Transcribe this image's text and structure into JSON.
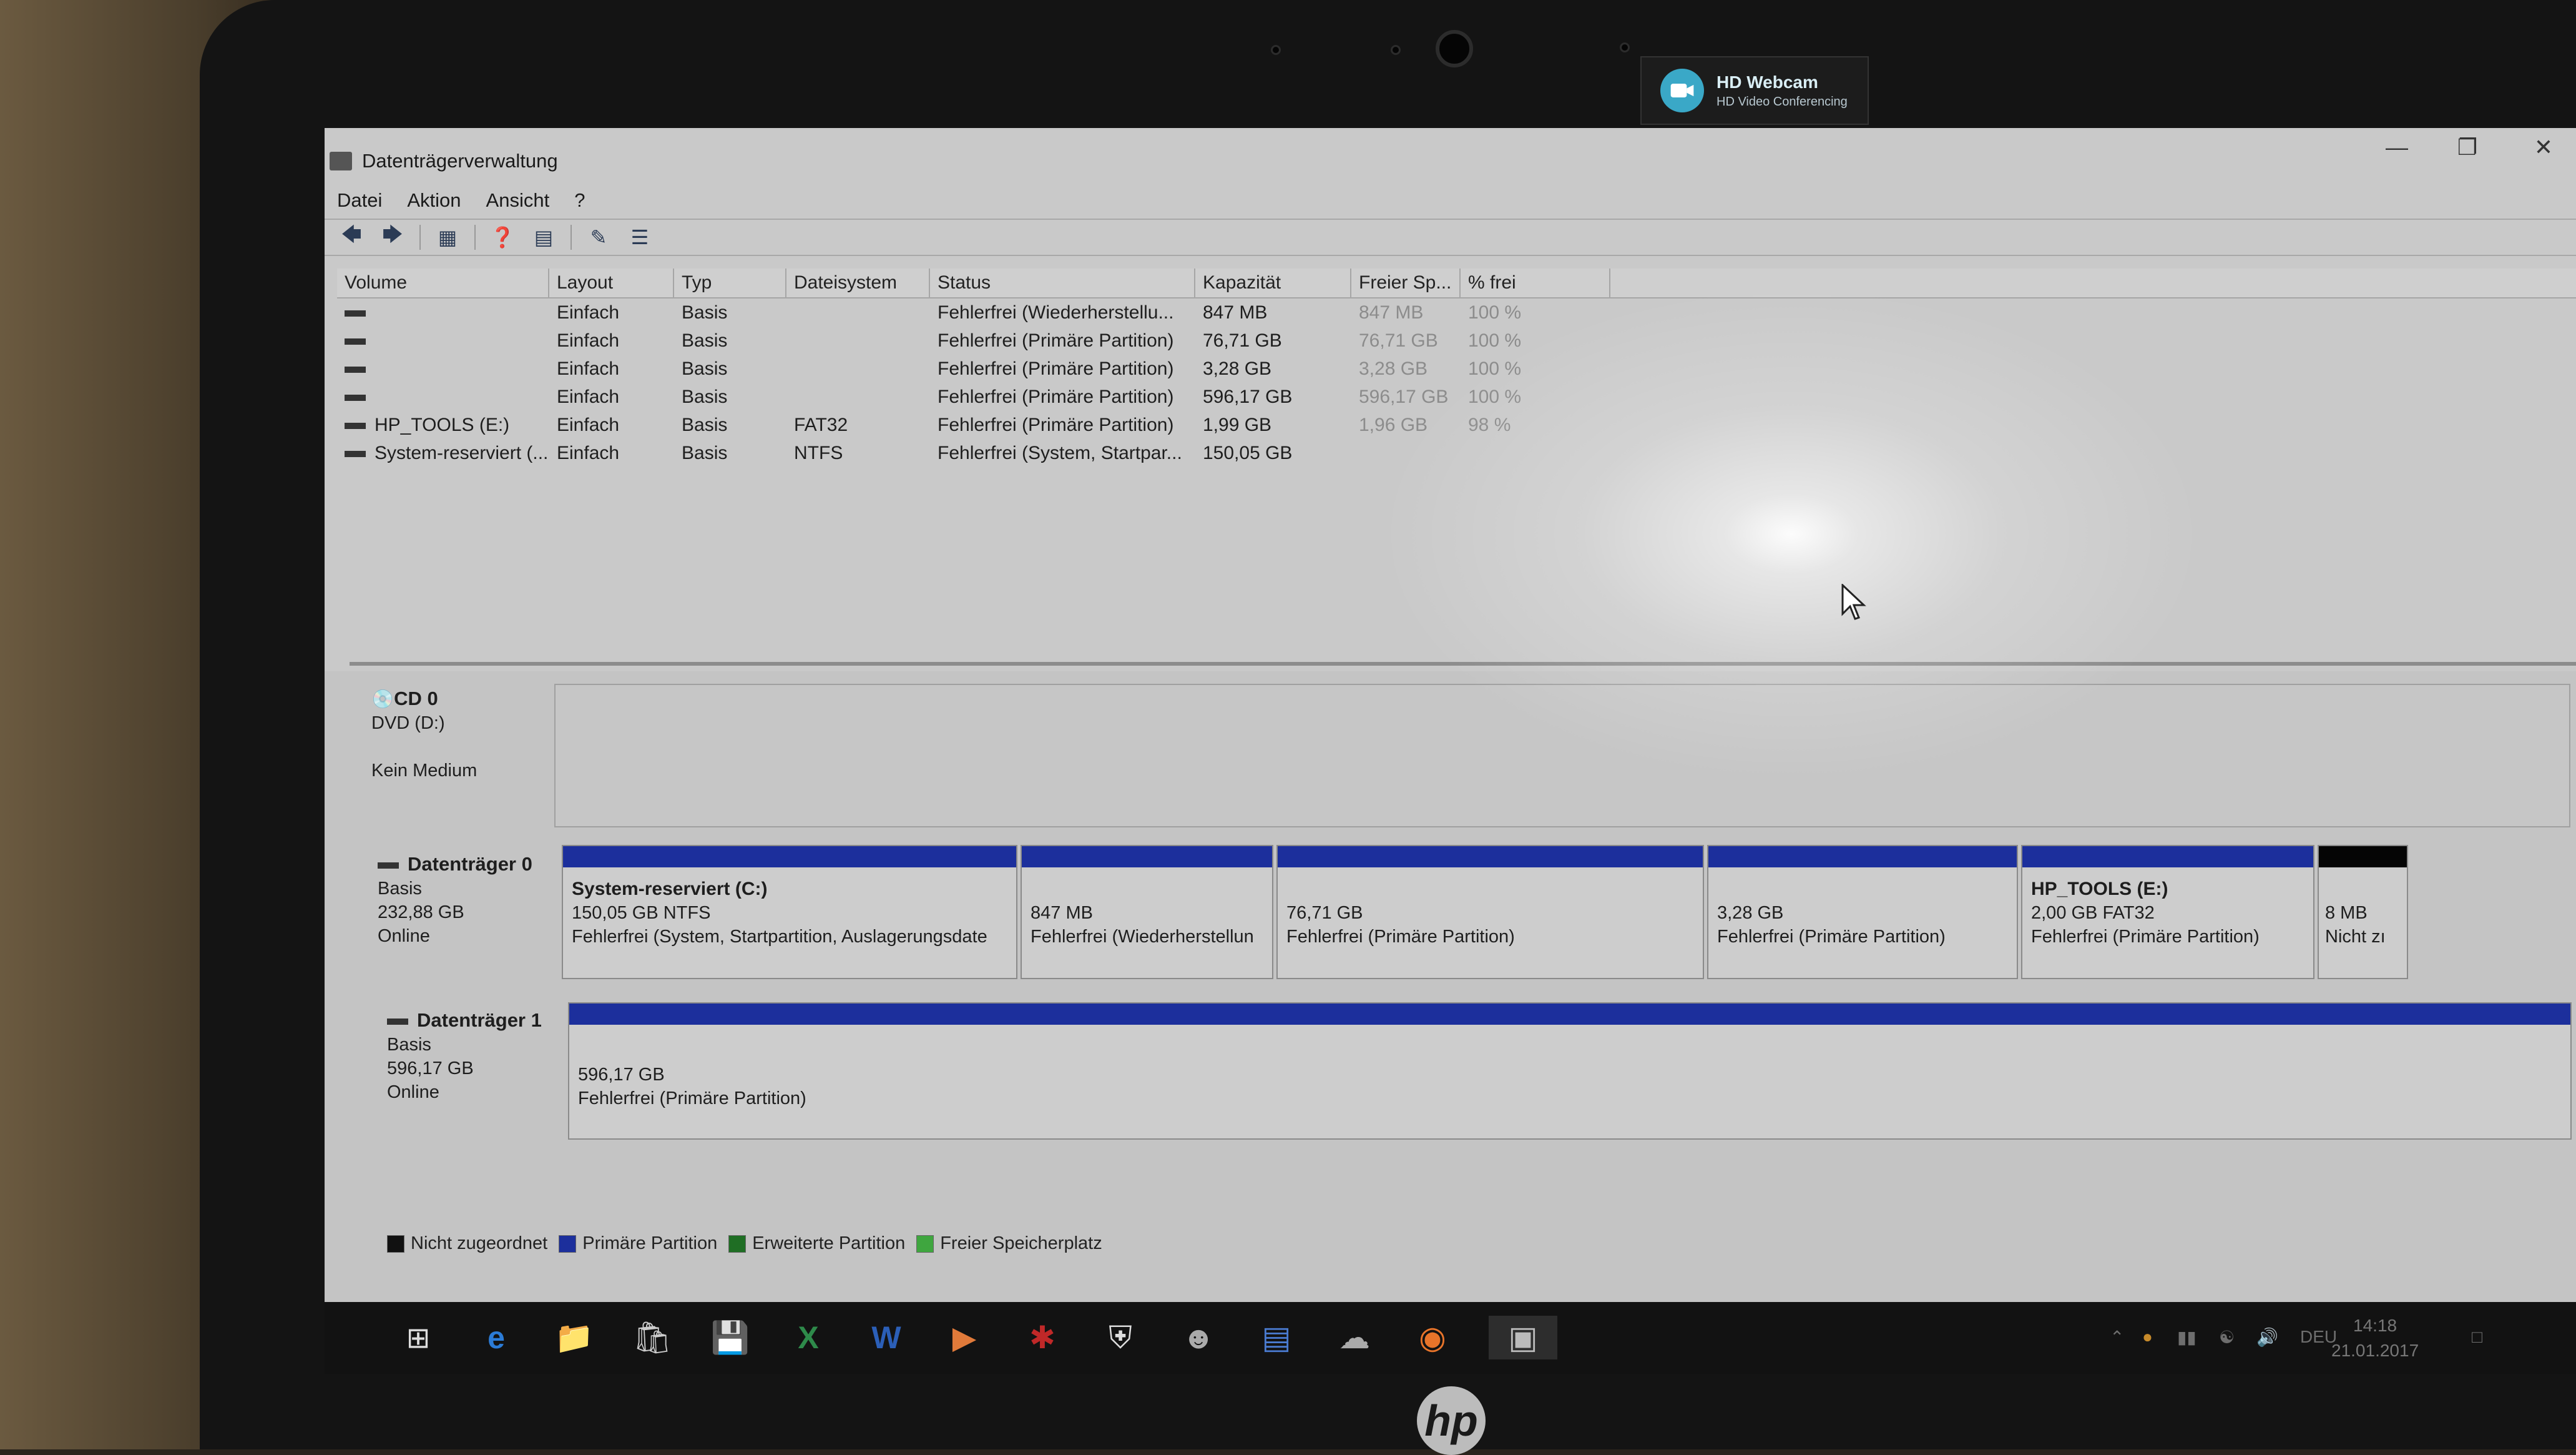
{
  "webcam": {
    "title": "HD Webcam",
    "subtitle": "HD Video Conferencing"
  },
  "device_logo": "hp",
  "window": {
    "title": "Datenträgerverwaltung"
  },
  "menu": [
    "Datei",
    "Aktion",
    "Ansicht",
    "?"
  ],
  "toolbar_icons": [
    "back-arrow-icon",
    "forward-arrow-icon",
    "console-tree-icon",
    "help-icon",
    "properties-icon",
    "refresh-icon",
    "list-view-icon"
  ],
  "volume_table": {
    "headers": [
      "Volume",
      "Layout",
      "Typ",
      "Dateisystem",
      "Status",
      "Kapazität",
      "Freier Sp...",
      "% frei"
    ],
    "rows": [
      {
        "volume": "",
        "layout": "Einfach",
        "typ": "Basis",
        "fs": "",
        "status": "Fehlerfrei (Wiederherstellu...",
        "cap": "847 MB",
        "free": "847 MB",
        "pct": "100 %"
      },
      {
        "volume": "",
        "layout": "Einfach",
        "typ": "Basis",
        "fs": "",
        "status": "Fehlerfrei (Primäre Partition)",
        "cap": "76,71 GB",
        "free": "76,71 GB",
        "pct": "100 %"
      },
      {
        "volume": "",
        "layout": "Einfach",
        "typ": "Basis",
        "fs": "",
        "status": "Fehlerfrei (Primäre Partition)",
        "cap": "3,28 GB",
        "free": "3,28 GB",
        "pct": "100 %"
      },
      {
        "volume": "",
        "layout": "Einfach",
        "typ": "Basis",
        "fs": "",
        "status": "Fehlerfrei (Primäre Partition)",
        "cap": "596,17 GB",
        "free": "596,17 GB",
        "pct": "100 %"
      },
      {
        "volume": "HP_TOOLS (E:)",
        "layout": "Einfach",
        "typ": "Basis",
        "fs": "FAT32",
        "status": "Fehlerfrei (Primäre Partition)",
        "cap": "1,99 GB",
        "free": "1,96 GB",
        "pct": "98 %"
      },
      {
        "volume": "System-reserviert (...",
        "layout": "Einfach",
        "typ": "Basis",
        "fs": "NTFS",
        "status": "Fehlerfrei (System, Startpar...",
        "cap": "150,05 GB",
        "free": "",
        "pct": ""
      }
    ]
  },
  "disks": {
    "cd0": {
      "name": "CD 0",
      "line1": "DVD (D:)",
      "line2": "Kein Medium"
    },
    "disk0": {
      "name": "Datenträger 0",
      "type": "Basis",
      "size": "232,88 GB",
      "state": "Online",
      "partitions": [
        {
          "title": "System-reserviert  (C:)",
          "line1": "150,05 GB NTFS",
          "line2": "Fehlerfrei (System, Startpartition, Auslagerungsdate"
        },
        {
          "title": "",
          "line1": "847 MB",
          "line2": "Fehlerfrei (Wiederherstellun"
        },
        {
          "title": "",
          "line1": "76,71 GB",
          "line2": "Fehlerfrei (Primäre Partition)"
        },
        {
          "title": "",
          "line1": "3,28 GB",
          "line2": "Fehlerfrei (Primäre Partition)"
        },
        {
          "title": "HP_TOOLS  (E:)",
          "line1": "2,00 GB FAT32",
          "line2": "Fehlerfrei (Primäre Partition)"
        },
        {
          "title": "",
          "line1": "8 MB",
          "line2": "Nicht zı"
        }
      ]
    },
    "disk1": {
      "name": "Datenträger 1",
      "type": "Basis",
      "size": "596,17 GB",
      "state": "Online",
      "partitions": [
        {
          "title": "",
          "line1": "596,17 GB",
          "line2": "Fehlerfrei (Primäre Partition)"
        }
      ]
    }
  },
  "legend": [
    {
      "label": "Nicht zugeordnet",
      "color": "#111111"
    },
    {
      "label": "Primäre Partition",
      "color": "#1c2f9c"
    },
    {
      "label": "Erweiterte Partition",
      "color": "#1f6e24"
    },
    {
      "label": "Freier Speicherplatz",
      "color": "#3fa63f"
    }
  ],
  "taskbar": {
    "apps": [
      "windows-start-icon",
      "edge-icon",
      "file-explorer-icon",
      "store-icon",
      "save-icon",
      "excel-icon",
      "word-icon",
      "media-player-icon",
      "tool-icon",
      "shield-icon",
      "user-icon",
      "network-icon",
      "cloud-icon",
      "firefox-icon",
      "disk-management-icon"
    ],
    "tray_language": "DEU",
    "time": "14:18",
    "date": "21.01.2017"
  }
}
